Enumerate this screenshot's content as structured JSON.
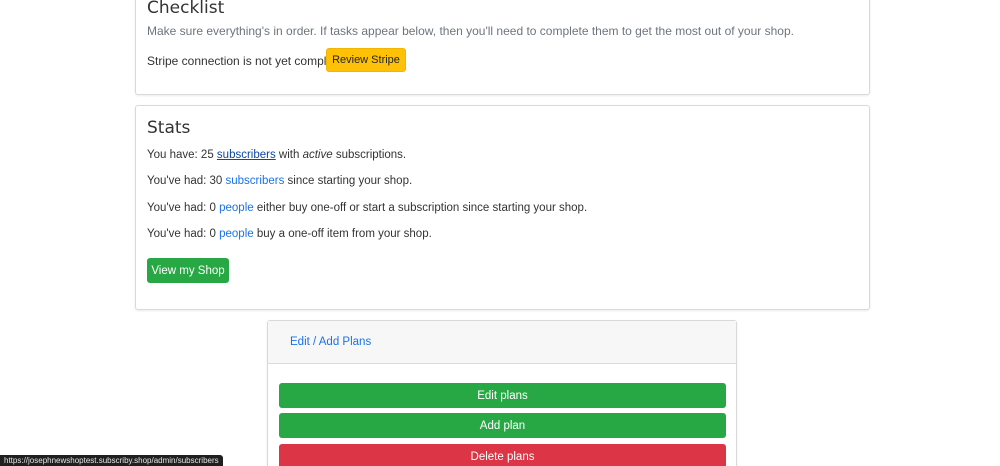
{
  "checklist": {
    "title": "Checklist",
    "description": "Make sure everything's in order. If tasks appear below, then you'll need to complete them to get the most out of your shop.",
    "stripe_message": "Stripe connection is not yet complete.",
    "review_stripe_label": "Review Stripe"
  },
  "stats": {
    "title": "Stats",
    "line1": {
      "prefix": "You have: 25 ",
      "link": "subscribers",
      "middle": " with ",
      "emphasis": "active",
      "suffix": " subscriptions."
    },
    "line2": {
      "prefix": "You've had: 30 ",
      "link": "subscribers",
      "suffix": " since starting your shop."
    },
    "line3": {
      "prefix": "You've had: 0 ",
      "link": "people",
      "suffix": " either buy one-off or start a subscription since starting your shop."
    },
    "line4": {
      "prefix": "You've had: 0 ",
      "link": "people",
      "suffix": " buy a one-off item from your shop."
    },
    "view_shop_label": "View my Shop"
  },
  "plans": {
    "header_link": "Edit / Add Plans",
    "edit_label": "Edit plans",
    "add_label": "Add plan",
    "delete_label": "Delete plans"
  },
  "status_bar": {
    "url": "https://josephnewshoptest.subscriby.shop/admin/subscribers"
  },
  "colors": {
    "primary_link": "#1a73e8",
    "success": "#28a745",
    "warning": "#ffc107",
    "danger": "#dc3545"
  }
}
